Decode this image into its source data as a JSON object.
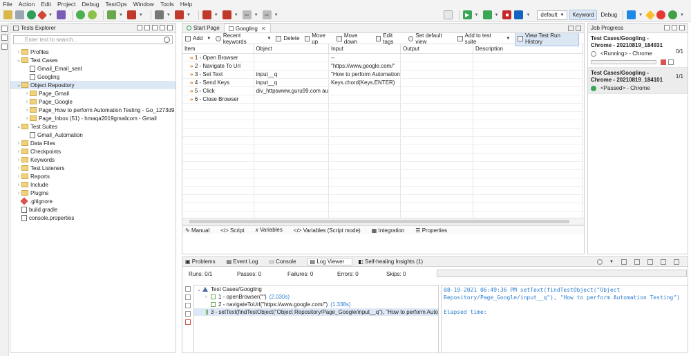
{
  "menu": [
    "File",
    "Action",
    "Edit",
    "Project",
    "Debug",
    "TestOps",
    "Window",
    "Tools",
    "Help"
  ],
  "toolbar": {
    "profile": "default",
    "keyword_mode": "Keyword",
    "debug_mode": "Debug"
  },
  "explorer": {
    "title": "Tests Explorer",
    "search_placeholder": "Enter text to search...",
    "items": [
      {
        "label": "Profiles",
        "level": 0,
        "type": "folder",
        "chev": "›"
      },
      {
        "label": "Test Cases",
        "level": 0,
        "type": "folder",
        "chev": "⌄"
      },
      {
        "label": "Gmail_Email_sent",
        "level": 1,
        "type": "doc",
        "chev": ""
      },
      {
        "label": "Googling",
        "level": 1,
        "type": "doc",
        "chev": ""
      },
      {
        "label": "Object Repository",
        "level": 0,
        "type": "folder",
        "chev": "⌄",
        "selected": true
      },
      {
        "label": "Page_Gmail",
        "level": 1,
        "type": "folder",
        "chev": "›"
      },
      {
        "label": "Page_Google",
        "level": 1,
        "type": "folder",
        "chev": "›"
      },
      {
        "label": "Page_How to perform Automation Testing - Go_1273d9",
        "level": 1,
        "type": "folder",
        "chev": "›"
      },
      {
        "label": "Page_Inbox (51) - hmaqa2019gmailcom - Gmail",
        "level": 1,
        "type": "folder",
        "chev": "›"
      },
      {
        "label": "Test Suites",
        "level": 0,
        "type": "folder",
        "chev": "⌄"
      },
      {
        "label": "Gmail_Automation",
        "level": 1,
        "type": "doc",
        "chev": ""
      },
      {
        "label": "Data Files",
        "level": 0,
        "type": "folder",
        "chev": "›"
      },
      {
        "label": "Checkpoints",
        "level": 0,
        "type": "folder",
        "chev": "›"
      },
      {
        "label": "Keywords",
        "level": 0,
        "type": "folder",
        "chev": "›"
      },
      {
        "label": "Test Listeners",
        "level": 0,
        "type": "folder",
        "chev": "›"
      },
      {
        "label": "Reports",
        "level": 0,
        "type": "folder",
        "chev": "›"
      },
      {
        "label": "Include",
        "level": 0,
        "type": "folder",
        "chev": "›"
      },
      {
        "label": "Plugins",
        "level": 0,
        "type": "folder",
        "chev": "›"
      },
      {
        "label": ".gitignore",
        "level": 0,
        "type": "red",
        "chev": ""
      },
      {
        "label": "build.gradle",
        "level": 0,
        "type": "doc",
        "chev": ""
      },
      {
        "label": "console.properties",
        "level": 0,
        "type": "doc",
        "chev": ""
      }
    ]
  },
  "editor": {
    "tabs": [
      "Start Page",
      "Googling"
    ],
    "actions": [
      "Add",
      "Recent keywords",
      "Delete",
      "Move up",
      "Move down",
      "Edit tags",
      "Set default view",
      "Add to test suite",
      "View Test Run History"
    ],
    "columns": [
      "Item",
      "Object",
      "Input",
      "Output",
      "Description"
    ],
    "rows": [
      {
        "item": "1 - Open Browser",
        "object": "",
        "input": "--",
        "output": "",
        "description": ""
      },
      {
        "item": "2 - Navigate To Url",
        "object": "",
        "input": "\"https://www.google.com/\"",
        "output": "",
        "description": ""
      },
      {
        "item": "3 - Set Text",
        "object": "input__q",
        "input": "\"How to perform Automation",
        "output": "",
        "description": ""
      },
      {
        "item": "4 - Send Keys",
        "object": "input__q",
        "input": "Keys.chord(Keys.ENTER)",
        "output": "",
        "description": ""
      },
      {
        "item": "5 - Click",
        "object": "div_httpswww.guru99.com  au",
        "input": "",
        "output": "",
        "description": ""
      },
      {
        "item": "6 - Close Browser",
        "object": "",
        "input": "",
        "output": "",
        "description": ""
      }
    ],
    "bottom_tabs": [
      "Manual",
      "Script",
      "Variables",
      "Variables (Script mode)",
      "Integration",
      "Properties"
    ]
  },
  "job_progress": {
    "title": "Job Progress",
    "jobs": [
      {
        "name": "Test Cases/Googling - Chrome - 20210819_184931",
        "count": "0/1",
        "status": "<Running> - Chrome",
        "running": true
      },
      {
        "name": "Test Cases/Googling - Chrome - 20210819_184101",
        "count": "1/1",
        "status": "<Passed> - Chrome",
        "running": false
      }
    ]
  },
  "log": {
    "tabs": [
      "Problems",
      "Event Log",
      "Console",
      "Log Viewer",
      "Self-healing Insights (1)"
    ],
    "stats": {
      "runs": "Runs: 0/1",
      "passes": "Passes: 0",
      "failures": "Failures: 0",
      "errors": "Errors: 0",
      "skips": "Skips: 0"
    },
    "tree": [
      {
        "label": "Test Cases/Googling",
        "time": "",
        "level": 0
      },
      {
        "label": "1 - openBrowser(\"\")",
        "time": "(2.030s)",
        "level": 1
      },
      {
        "label": "2 - navigateToUrl(\"https://www.google.com/\")",
        "time": "(1.338s)",
        "level": 1
      },
      {
        "label": "3 - setText(findTestObject(\"Object Repository/Page_Google/input__q\"), \"How to perform Auto",
        "time": "",
        "level": 1,
        "selected": true
      }
    ],
    "detail": "08-19-2021 06:49:36 PM setText(findTestObject(\"Object\nRepository/Page_Google/input__q\"), \"How to perform Automation Testing\")\n\nElapsed time:"
  }
}
